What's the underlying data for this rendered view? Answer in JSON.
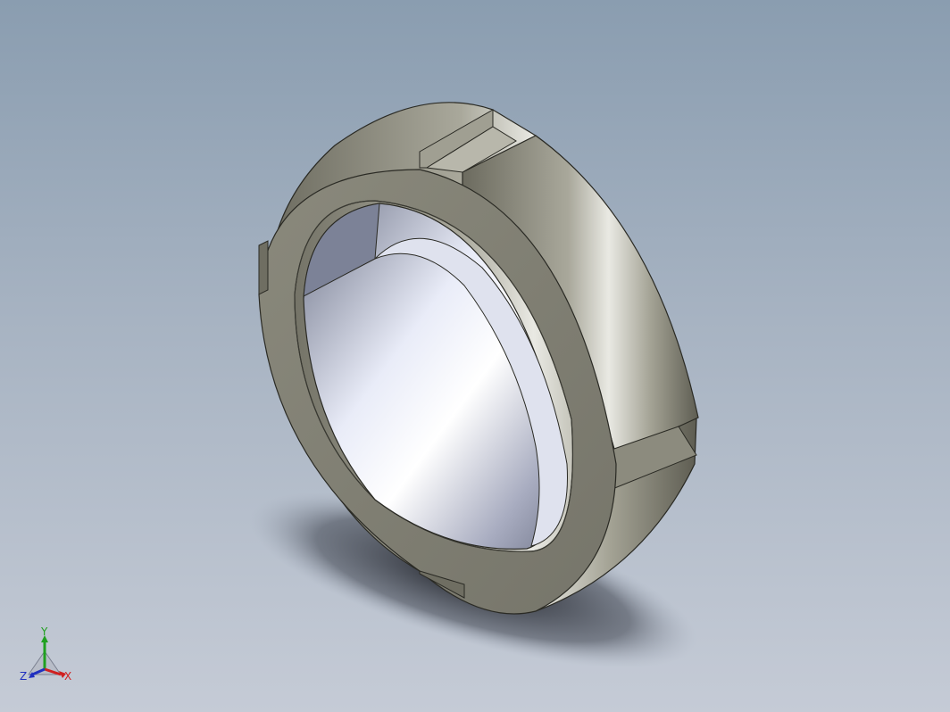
{
  "viewport": {
    "model": "lock-nut",
    "background_top": "#8a9db0",
    "background_bottom": "#c5cbd6",
    "model_color": "#8f8e80"
  },
  "triad": {
    "x_label": "X",
    "y_label": "Y",
    "z_label": "Z",
    "x_color": "#d02020",
    "y_color": "#20a020",
    "z_color": "#2030c0"
  }
}
